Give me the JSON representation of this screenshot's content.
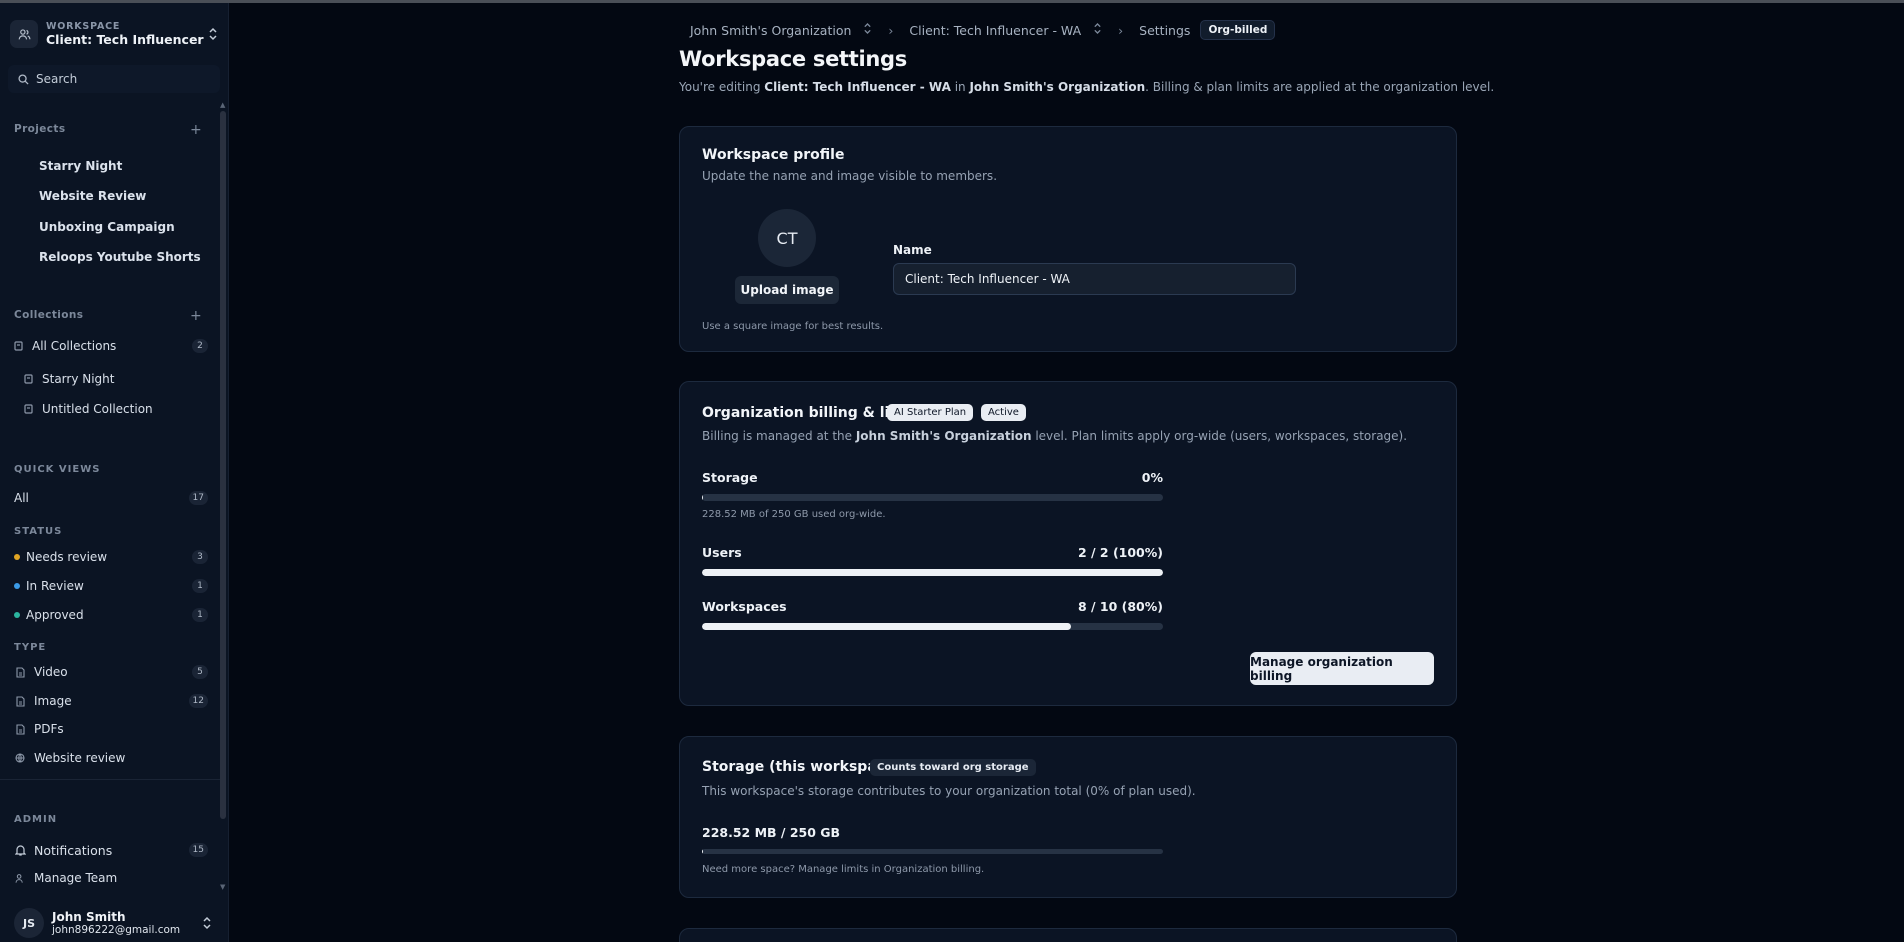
{
  "sidebar": {
    "workspace_label": "WORKSPACE",
    "workspace_name": "Client: Tech Influencer -...",
    "search_placeholder": "Search",
    "projects_label": "Projects",
    "projects": [
      "Starry Night",
      "Website Review",
      "Unboxing Campaign",
      "Reloops Youtube Shorts"
    ],
    "collections_label": "Collections",
    "all_collections": {
      "label": "All Collections",
      "count": "2"
    },
    "collections": [
      "Starry Night",
      "Untitled Collection"
    ],
    "quick_views_label": "QUICK VIEWS",
    "all_view": {
      "label": "All",
      "count": "17"
    },
    "status_label": "STATUS",
    "statuses": [
      {
        "label": "Needs review",
        "count": "3",
        "color": "#e0a524"
      },
      {
        "label": "In Review",
        "count": "1",
        "color": "#3b9be8"
      },
      {
        "label": "Approved",
        "count": "1",
        "color": "#2bb5a0"
      }
    ],
    "type_label": "TYPE",
    "types": [
      {
        "label": "Video",
        "count": "5",
        "icon": "file-icon"
      },
      {
        "label": "Image",
        "count": "12",
        "icon": "file-icon"
      },
      {
        "label": "PDFs",
        "count": "",
        "icon": "file-icon"
      },
      {
        "label": "Website review",
        "count": "",
        "icon": "globe-icon"
      }
    ],
    "admin_label": "ADMIN",
    "notifications": {
      "label": "Notifications",
      "count": "15"
    },
    "manage_team": "Manage Team",
    "user": {
      "initials": "JS",
      "name": "John Smith",
      "email": "john896222@gmail.com"
    }
  },
  "breadcrumb": {
    "org": "John Smith's Organization",
    "workspace": "Client: Tech Influencer - WA",
    "page": "Settings",
    "badge": "Org-billed"
  },
  "header": {
    "title": "Workspace settings",
    "sub_prefix": "You're editing ",
    "sub_workspace": "Client: Tech Influencer - WA",
    "sub_in": " in ",
    "sub_org": "John Smith's Organization",
    "sub_suffix": ". Billing & plan limits are applied at the organization level."
  },
  "profile": {
    "title": "Workspace profile",
    "subtitle": "Update the name and image visible to members.",
    "avatar_initials": "CT",
    "upload_label": "Upload image",
    "hint": "Use a square image for best results.",
    "name_label": "Name",
    "name_value": "Client: Tech Influencer - WA"
  },
  "billing": {
    "title": "Organization billing & limits",
    "plan_badge": "AI Starter Plan",
    "status_badge": "Active",
    "sub_prefix": "Billing is managed at the ",
    "sub_org": "John Smith's Organization",
    "sub_suffix": " level. Plan limits apply org-wide (users, workspaces, storage).",
    "storage": {
      "label": "Storage",
      "value": "0%",
      "fraction": 0.001,
      "note": "228.52 MB of 250 GB used org-wide."
    },
    "users": {
      "label": "Users",
      "value": "2 / 2 (100%)",
      "fraction": 1.0
    },
    "workspaces": {
      "label": "Workspaces",
      "value": "8 / 10 (80%)",
      "fraction": 0.8
    },
    "manage_button": "Manage organization billing"
  },
  "ws_storage": {
    "title": "Storage (this workspace)",
    "badge": "Counts toward org storage",
    "subtitle": "This workspace's storage contributes to your organization total (0% of plan used).",
    "usage": "228.52 MB / 250 GB",
    "fraction": 0.001,
    "note": "Need more space? Manage limits in Organization billing."
  }
}
